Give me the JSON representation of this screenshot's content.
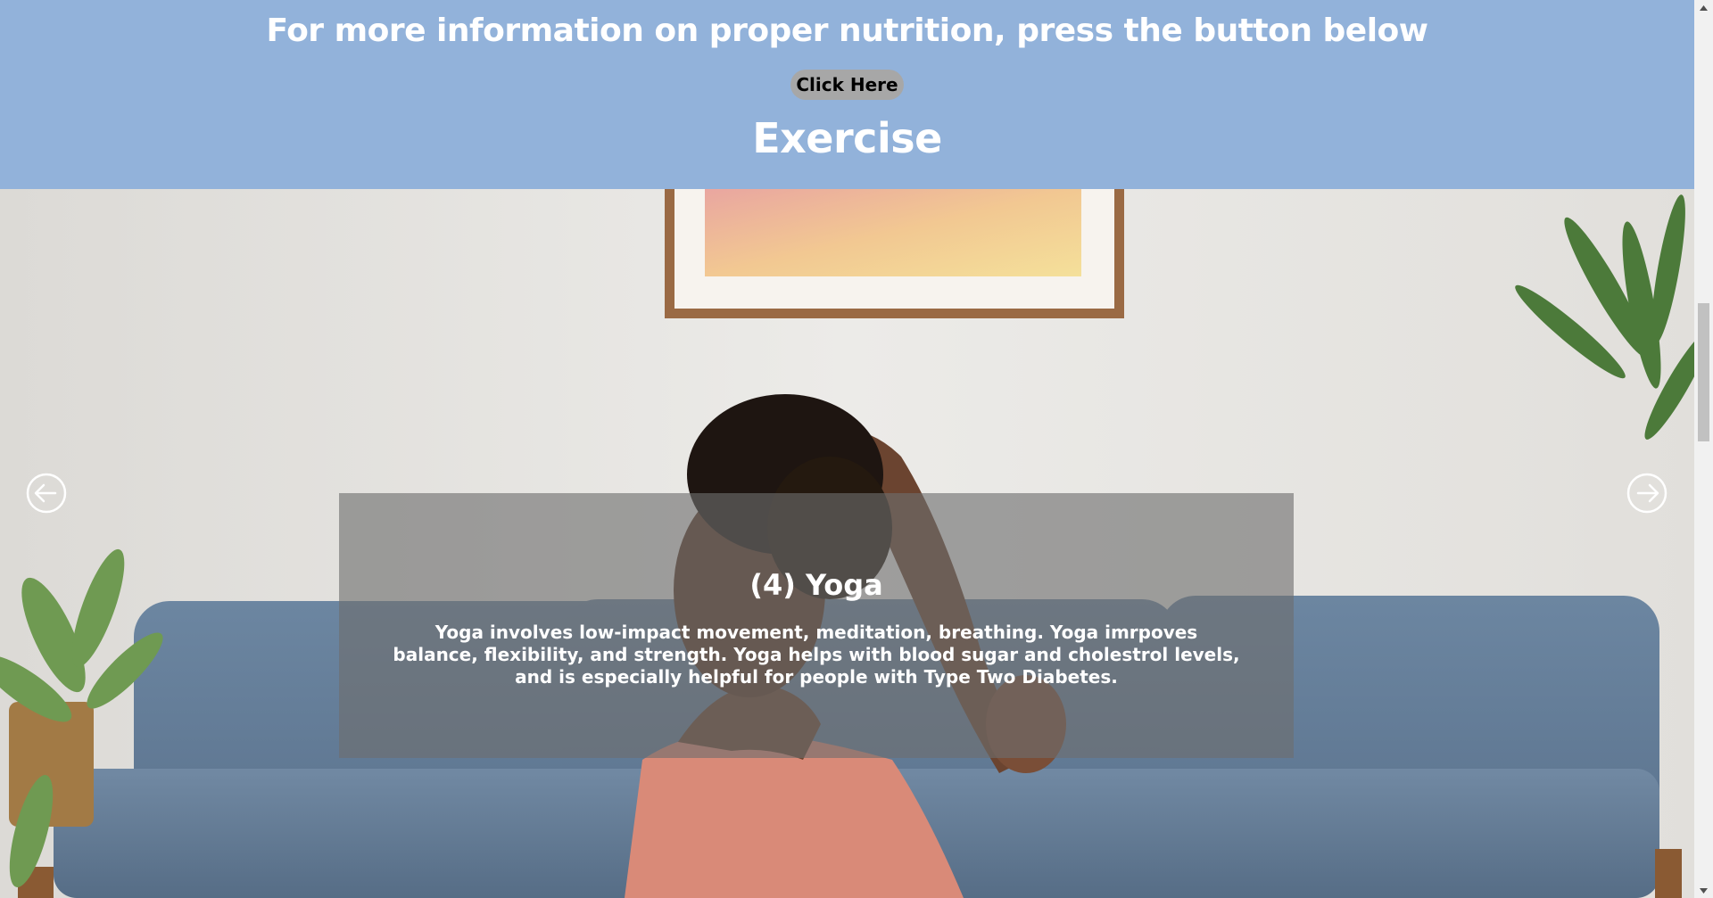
{
  "header": {
    "nutrition_text": "For more information on proper nutrition, press the button below",
    "button_label": "Click Here",
    "section_title": "Exercise",
    "background_color": "#92b2da"
  },
  "slideshow": {
    "slide_title": "(4) Yoga",
    "slide_text": "Yoga involves low-impact movement, meditation, breathing. Yoga imrpoves balance, flexibility, and strength. Yoga helps with blood sugar and cholestrol levels, and is especially helpful for people with Type Two Diabetes.",
    "prev_icon": "arrow-left-circle-icon",
    "next_icon": "arrow-right-circle-icon"
  },
  "scrollbar": {
    "up_icon": "triangle-up-icon",
    "down_icon": "triangle-down-icon"
  }
}
